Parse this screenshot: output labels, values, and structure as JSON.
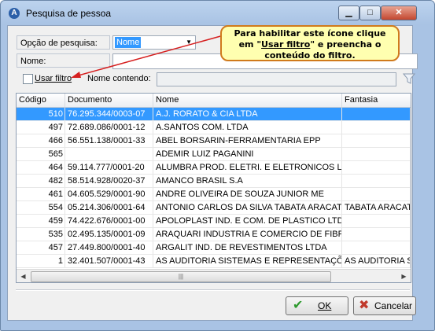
{
  "window": {
    "title": "Pesquisa de pessoa"
  },
  "titlebar_buttons": {
    "minimize": "▁",
    "maximize": "□",
    "close": "✕"
  },
  "search": {
    "option_label": "Opção de pesquisa:",
    "option_value": "Nome",
    "name_label": "Nome:",
    "name_value": "",
    "use_filter_label": "Usar filtro",
    "name_contains_label": "Nome contendo:",
    "name_contains_value": ""
  },
  "tooltip": {
    "line1": "Para habilitar este ícone clique",
    "line2_prefix": "em \"",
    "line2_link": "Usar filtro",
    "line2_suffix": "\" e preencha o",
    "line3": "conteúdo do filtro."
  },
  "table": {
    "headers": [
      "Código",
      "Documento",
      "Nome",
      "Fantasia"
    ],
    "rows": [
      [
        "510",
        "76.295.344/0003-07",
        "A.J. RORATO & CIA LTDA",
        ""
      ],
      [
        "497",
        "72.689.086/0001-12",
        "A.SANTOS COM. LTDA",
        ""
      ],
      [
        "466",
        "56.551.138/0001-33",
        "ABEL BORSARIN-FERRAMENTARIA EPP",
        ""
      ],
      [
        "565",
        "",
        "ADEMIR LUIZ PAGANINI",
        ""
      ],
      [
        "464",
        "59.114.777/0001-20",
        "ALUMBRA PROD. ELETRI. E ELETRONICOS LTDA",
        ""
      ],
      [
        "482",
        "58.514.928/0020-37",
        "AMANCO BRASIL S.A",
        ""
      ],
      [
        "461",
        "04.605.529/0001-90",
        "ANDRE OLIVEIRA DE SOUZA JUNIOR ME",
        ""
      ],
      [
        "554",
        "05.214.306/0001-64",
        "ANTONIO CARLOS DA SILVA TABATA ARACATUBA",
        "TABATA ARACATUBA"
      ],
      [
        "459",
        "74.422.676/0001-00",
        "APOLOPLAST IND. E COM. DE PLASTICO LTDA",
        ""
      ],
      [
        "535",
        "02.495.135/0001-09",
        "ARAQUARI INDUSTRIA E COMERCIO DE FIBRAS",
        ""
      ],
      [
        "457",
        "27.449.800/0001-40",
        "ARGALIT IND. DE REVESTIMENTOS LTDA",
        ""
      ],
      [
        "1",
        "32.401.507/0001-43",
        "AS AUDITORIA SISTEMAS E REPRESENTAÇÕES",
        "AS AUDITORIA SISTEMAS"
      ]
    ],
    "selected_row": 0,
    "scroll_thumb_glyph": "|||"
  },
  "buttons": {
    "ok_label": "OK",
    "ok_icon": "✔",
    "cancel_label": "Cancelar",
    "cancel_icon": "✖"
  },
  "colors": {
    "selection": "#3399ff",
    "ok_icon": "#2e9a2e",
    "cancel_icon": "#c0392b",
    "tooltip_border": "#d07a1c"
  },
  "icons": [
    "app-icon",
    "filter-icon",
    "checkmark-icon",
    "cross-icon",
    "dropdown-arrow-icon"
  ]
}
